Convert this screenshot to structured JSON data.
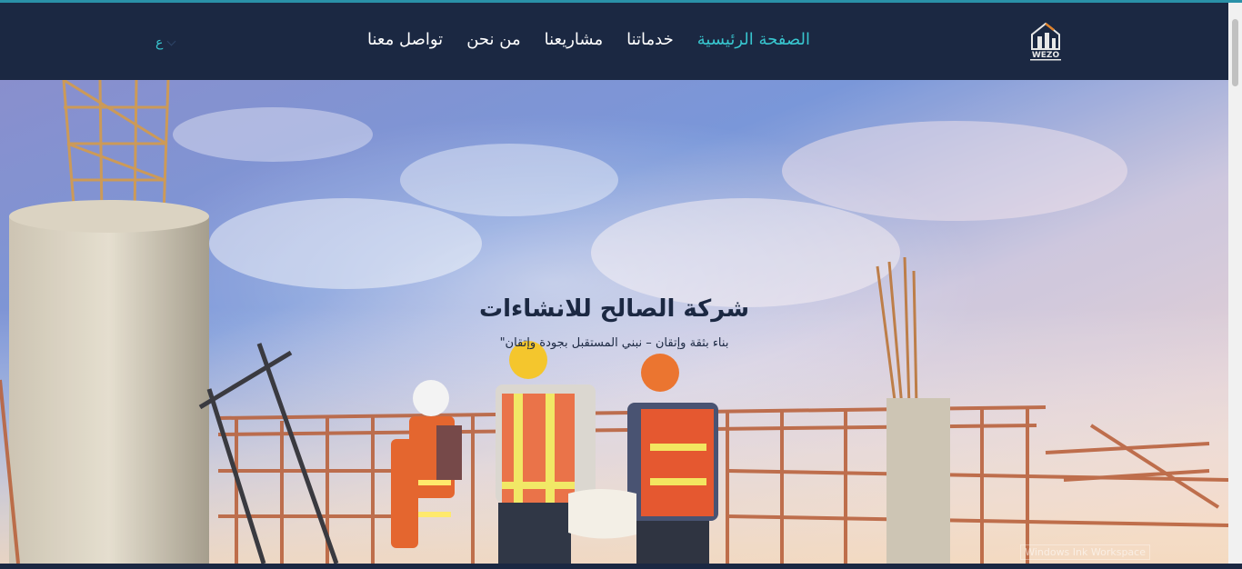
{
  "header": {
    "logo_text": "WEZO",
    "nav": [
      {
        "label": "الصفحة الرئيسية",
        "active": true
      },
      {
        "label": "خدماتنا",
        "active": false
      },
      {
        "label": "مشاريعنا",
        "active": false
      },
      {
        "label": "من نحن",
        "active": false
      },
      {
        "label": "تواصل معنا",
        "active": false
      }
    ],
    "language_label": "ع"
  },
  "hero": {
    "title": "شركة الصالح للانشاءات",
    "subtitle": "بناء بثقة وإتقان – نبني المستقبل بجودة وإتقان\""
  },
  "overlay": {
    "watermark_text": "Windows Ink Workspace"
  },
  "colors": {
    "navbar_bg": "#1b2842",
    "accent": "#38c6cf",
    "text_dark": "#1b2842"
  }
}
